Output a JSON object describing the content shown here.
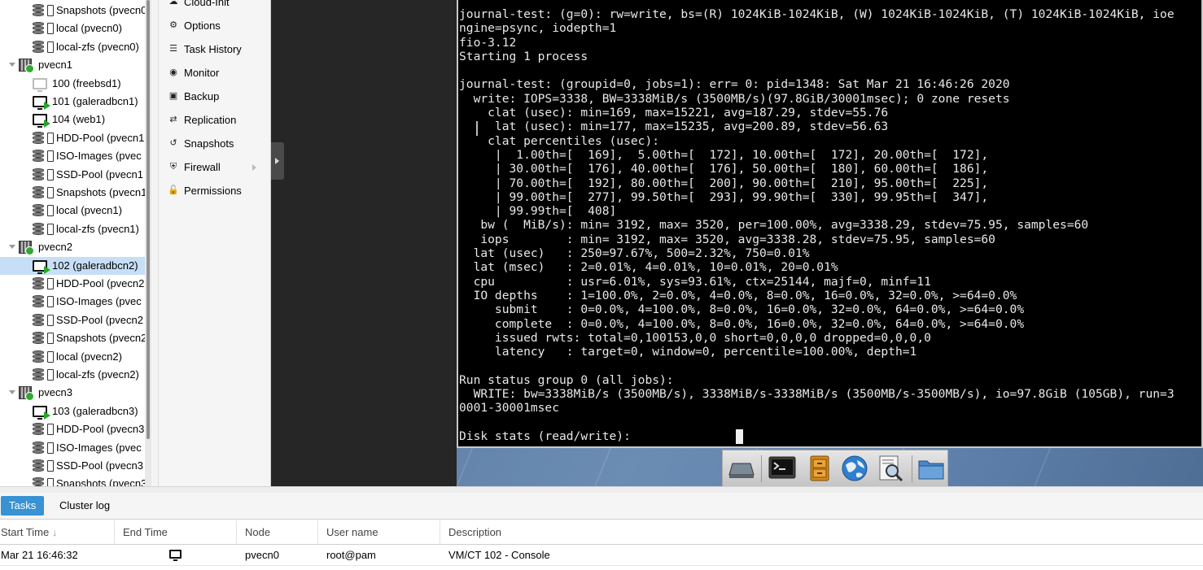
{
  "tree": {
    "items": [
      {
        "label": "Snapshots (pvecn0",
        "type": "storage",
        "indent": 2
      },
      {
        "label": "local (pvecn0)",
        "type": "storage",
        "indent": 2
      },
      {
        "label": "local-zfs (pvecn0)",
        "type": "storage",
        "indent": 2
      },
      {
        "label": "pvecn1",
        "type": "node",
        "indent": 1
      },
      {
        "label": "100 (freebsd1)",
        "type": "vm-stopped",
        "indent": 2
      },
      {
        "label": "101 (galeradbcn1)",
        "type": "vm-running",
        "indent": 2
      },
      {
        "label": "104 (web1)",
        "type": "vm-running",
        "indent": 2
      },
      {
        "label": "HDD-Pool (pvecn1",
        "type": "storage",
        "indent": 2
      },
      {
        "label": "ISO-Images (pvec",
        "type": "storage",
        "indent": 2
      },
      {
        "label": "SSD-Pool (pvecn1",
        "type": "storage",
        "indent": 2
      },
      {
        "label": "Snapshots (pvecn1",
        "type": "storage",
        "indent": 2
      },
      {
        "label": "local (pvecn1)",
        "type": "storage",
        "indent": 2
      },
      {
        "label": "local-zfs (pvecn1)",
        "type": "storage",
        "indent": 2
      },
      {
        "label": "pvecn2",
        "type": "node",
        "indent": 1
      },
      {
        "label": "102 (galeradbcn2)",
        "type": "vm-running",
        "indent": 2,
        "selected": true
      },
      {
        "label": "HDD-Pool (pvecn2",
        "type": "storage",
        "indent": 2
      },
      {
        "label": "ISO-Images (pvec",
        "type": "storage",
        "indent": 2
      },
      {
        "label": "SSD-Pool (pvecn2",
        "type": "storage",
        "indent": 2
      },
      {
        "label": "Snapshots (pvecn2",
        "type": "storage",
        "indent": 2
      },
      {
        "label": "local (pvecn2)",
        "type": "storage",
        "indent": 2
      },
      {
        "label": "local-zfs (pvecn2)",
        "type": "storage",
        "indent": 2
      },
      {
        "label": "pvecn3",
        "type": "node",
        "indent": 1
      },
      {
        "label": "103 (galeradbcn3)",
        "type": "vm-running",
        "indent": 2
      },
      {
        "label": "HDD-Pool (pvecn3",
        "type": "storage",
        "indent": 2
      },
      {
        "label": "ISO-Images (pvec",
        "type": "storage",
        "indent": 2
      },
      {
        "label": "SSD-Pool (pvecn3",
        "type": "storage",
        "indent": 2
      },
      {
        "label": "Snapshots (pvecn3",
        "type": "storage",
        "indent": 2
      }
    ]
  },
  "vm_menu": {
    "items": [
      {
        "label": "Cloud-Init",
        "icon": "cloud-icon",
        "glyph": "☁"
      },
      {
        "label": "Options",
        "icon": "gear-icon",
        "glyph": "⚙"
      },
      {
        "label": "Task History",
        "icon": "list-icon",
        "glyph": "☰"
      },
      {
        "label": "Monitor",
        "icon": "eye-icon",
        "glyph": "◉"
      },
      {
        "label": "Backup",
        "icon": "floppy-icon",
        "glyph": "▣"
      },
      {
        "label": "Replication",
        "icon": "retweet-icon",
        "glyph": "⇄"
      },
      {
        "label": "Snapshots",
        "icon": "history-icon",
        "glyph": "↺"
      },
      {
        "label": "Firewall",
        "icon": "shield-icon",
        "glyph": "⛨",
        "submenu": true
      },
      {
        "label": "Permissions",
        "icon": "unlock-icon",
        "glyph": "🔓"
      }
    ]
  },
  "console": {
    "text": "journal-test: (g=0): rw=write, bs=(R) 1024KiB-1024KiB, (W) 1024KiB-1024KiB, (T) 1024KiB-1024KiB, ioe\nngine=psync, iodepth=1\nfio-3.12\nStarting 1 process\n\njournal-test: (groupid=0, jobs=1): err= 0: pid=1348: Sat Mar 21 16:46:26 2020\n  write: IOPS=3338, BW=3338MiB/s (3500MB/s)(97.8GiB/30001msec); 0 zone resets\n    clat (usec): min=169, max=15221, avg=187.29, stdev=55.76\n     lat (usec): min=177, max=15235, avg=200.89, stdev=56.63\n    clat percentiles (usec):\n     |  1.00th=[  169],  5.00th=[  172], 10.00th=[  172], 20.00th=[  172],\n     | 30.00th=[  176], 40.00th=[  176], 50.00th=[  180], 60.00th=[  186],\n     | 70.00th=[  192], 80.00th=[  200], 90.00th=[  210], 95.00th=[  225],\n     | 99.00th=[  277], 99.50th=[  293], 99.90th=[  330], 99.95th=[  347],\n     | 99.99th=[  408]\n   bw (  MiB/s): min= 3192, max= 3520, per=100.00%, avg=3338.29, stdev=75.95, samples=60\n   iops        : min= 3192, max= 3520, avg=3338.28, stdev=75.95, samples=60\n  lat (usec)   : 250=97.67%, 500=2.32%, 750=0.01%\n  lat (msec)   : 2=0.01%, 4=0.01%, 10=0.01%, 20=0.01%\n  cpu          : usr=6.01%, sys=93.61%, ctx=25144, majf=0, minf=11\n  IO depths    : 1=100.0%, 2=0.0%, 4=0.0%, 8=0.0%, 16=0.0%, 32=0.0%, >=64=0.0%\n     submit    : 0=0.0%, 4=100.0%, 8=0.0%, 16=0.0%, 32=0.0%, 64=0.0%, >=64=0.0%\n     complete  : 0=0.0%, 4=100.0%, 8=0.0%, 16=0.0%, 32=0.0%, 64=0.0%, >=64=0.0%\n     issued rwts: total=0,100153,0,0 short=0,0,0,0 dropped=0,0,0,0\n     latency   : target=0, window=0, percentile=100.00%, depth=1\n\nRun status group 0 (all jobs):\n  WRITE: bw=3338MiB/s (3500MB/s), 3338MiB/s-3338MiB/s (3500MB/s-3500MB/s), io=97.8GiB (105GB), run=3\n0001-30001msec\n\nDisk stats (read/write):"
  },
  "dock": {
    "icons": [
      "drive-icon",
      "terminal-icon",
      "file-cabinet-icon",
      "globe-icon",
      "search-document-icon",
      "folder-icon"
    ]
  },
  "bottom": {
    "tabs": [
      {
        "label": "Tasks",
        "active": true
      },
      {
        "label": "Cluster log",
        "active": false
      }
    ],
    "columns": [
      "Start Time",
      "End Time",
      "Node",
      "User name",
      "Description"
    ],
    "rows": [
      {
        "start_time": "Mar 21 16:46:32",
        "end_time_icon": "monitor-icon",
        "node": "pvecn0",
        "user": "root@pam",
        "description": "VM/CT 102 - Console"
      }
    ]
  },
  "colors": {
    "accent": "#3892d4",
    "selection": "#c7dff6",
    "running": "#22aa22"
  }
}
